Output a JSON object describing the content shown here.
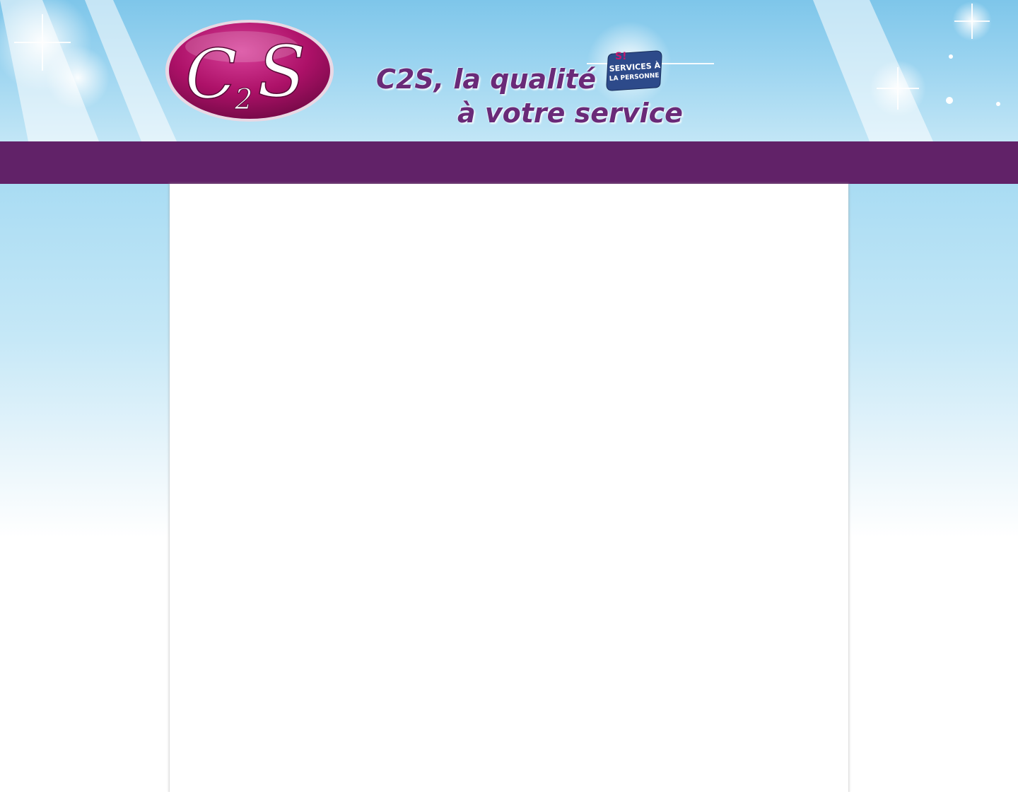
{
  "header": {
    "logo_text": "C2S",
    "tagline_line1": "C2S, la qualité",
    "tagline_line2": "à votre service",
    "badge": {
      "mark": "S!",
      "line1": "SERVICES À",
      "line2": "LA PERSONNE"
    }
  },
  "colors": {
    "nav_background": "#612268",
    "tagline": "#6a2a78",
    "logo_oval": "#b0166e",
    "badge_background": "#2d4a8a",
    "sky": "#9bd4f0"
  },
  "navbar": {
    "items": []
  },
  "main": {
    "content": ""
  }
}
